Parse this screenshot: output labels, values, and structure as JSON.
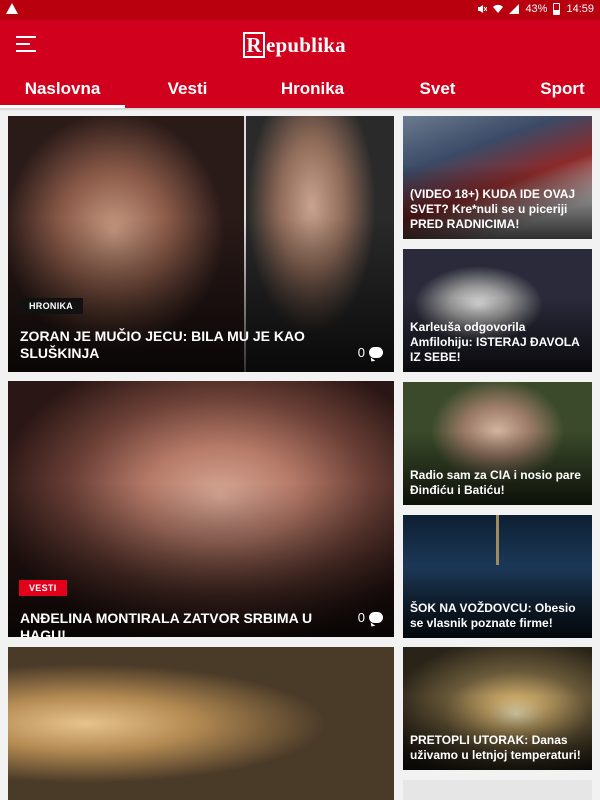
{
  "status_bar": {
    "battery": "43%",
    "time": "14:59",
    "icons": [
      "warning-icon",
      "mute-icon",
      "wifi-icon",
      "signal-icon",
      "battery-icon"
    ]
  },
  "app": {
    "brand": "Republika",
    "brand_initial": "R",
    "brand_rest": "epublika",
    "accent_color": "#d1001c"
  },
  "tabs": [
    {
      "label": "Naslovna",
      "active": true
    },
    {
      "label": "Vesti",
      "active": false
    },
    {
      "label": "Hronika",
      "active": false
    },
    {
      "label": "Svet",
      "active": false
    },
    {
      "label": "Sport",
      "active": false
    }
  ],
  "featured": [
    {
      "category": "HRONIKA",
      "title": "ZORAN JE MUČIO JECU: BILA MU JE KAO SLUŠKINJA",
      "comments": "0"
    },
    {
      "category": "VESTI",
      "title": "ANĐELINA MONTIRALA ZATVOR SRBIMA U HAGU!",
      "comments": "0"
    }
  ],
  "side_news": [
    {
      "title": "(VIDEO 18+) KUDA IDE OVAJ SVET? Kre*nuli se u piceriji PRED RADNICIMA!"
    },
    {
      "title": "Karleuša odgovorila Amfilohiju: ISTERAJ ĐAVOLA IZ SEBE!"
    },
    {
      "title": "Radio sam za CIA i nosio pare Đinđiću i Batiću!"
    },
    {
      "title": "ŠOK NA VOŽDOVCU: Obesio se vlasnik poznate firme!"
    },
    {
      "title": "PRETOPLI UTORAK: Danas uživamo u letnjoj temperaturi!"
    }
  ]
}
